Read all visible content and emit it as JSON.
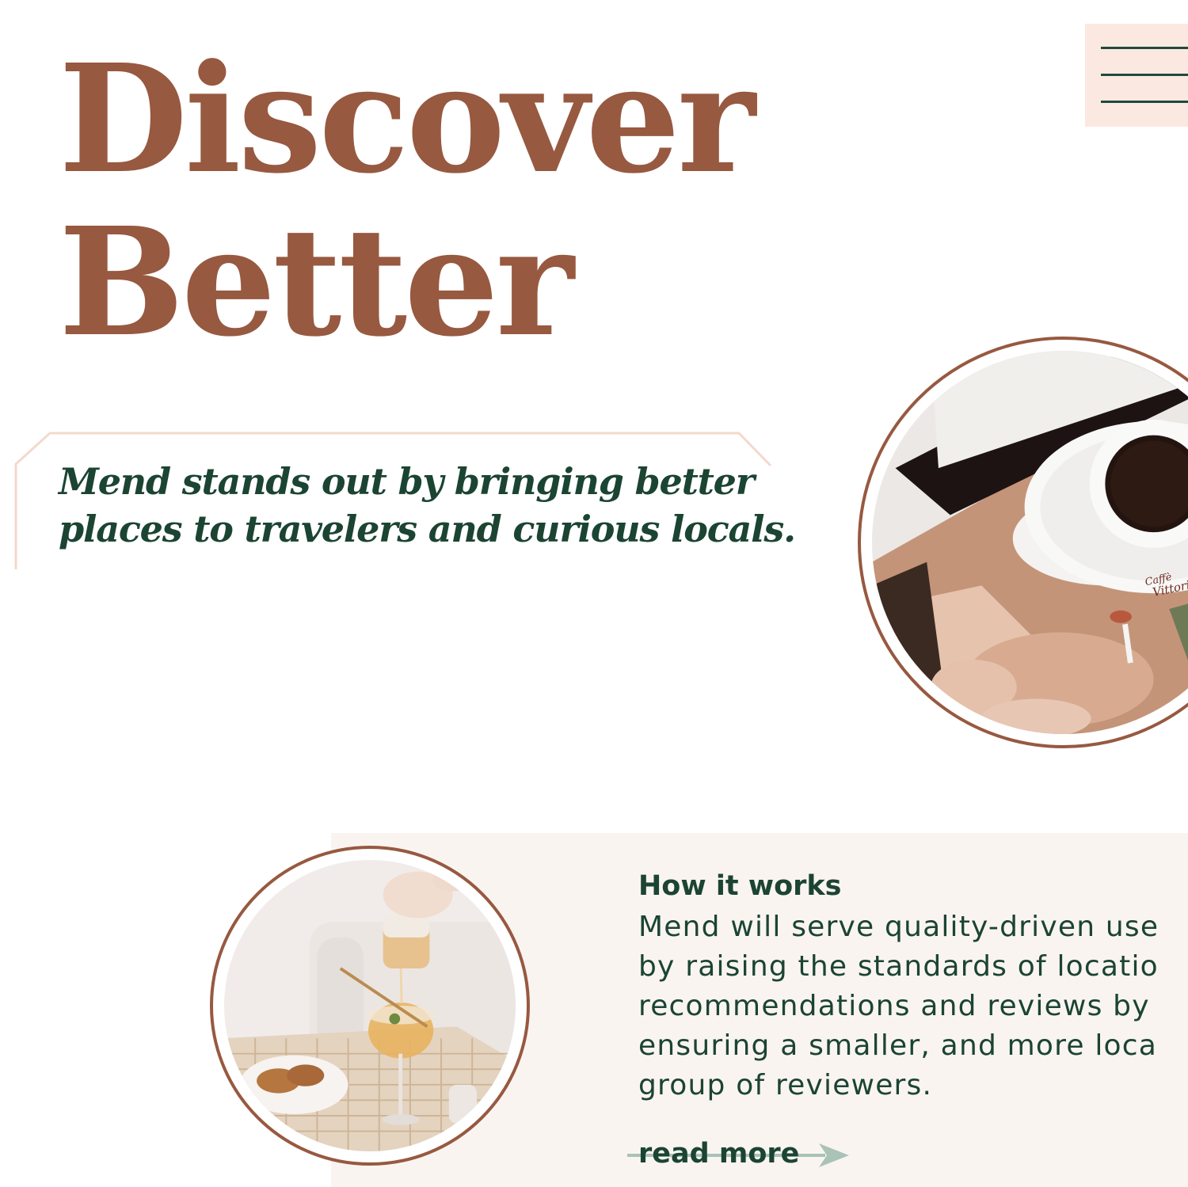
{
  "hero": {
    "title_line1": "Discover",
    "title_line2": "Better"
  },
  "menu": {
    "icon": "hamburger-menu-icon"
  },
  "tagline": {
    "line1": "Mend stands out by bringing better",
    "line2": "places to travelers and curious locals."
  },
  "images": {
    "coffee_photo": "coffee-and-magazine-photo",
    "drink_photo": "iced-tea-and-croissants-photo",
    "coffee_cup_text_1": "Caffè",
    "coffee_cup_text_2": "Vittoria"
  },
  "how_it_works": {
    "title": "How it works",
    "body_lines": [
      "Mend will serve quality-driven use",
      "by raising the standards of locatio",
      "recommendations and reviews by",
      "ensuring a smaller, and more loca",
      "group of reviewers."
    ],
    "read_more_label": "read more",
    "read_more_icon": "arrow-right-icon"
  },
  "colors": {
    "brand_brown": "#975940",
    "brand_green": "#1b4433",
    "menu_bg": "#fbe8e0",
    "panel_bg": "#faf4f1",
    "frame_line": "#f3d9cd",
    "arrow_green": "#a9c3b6"
  }
}
